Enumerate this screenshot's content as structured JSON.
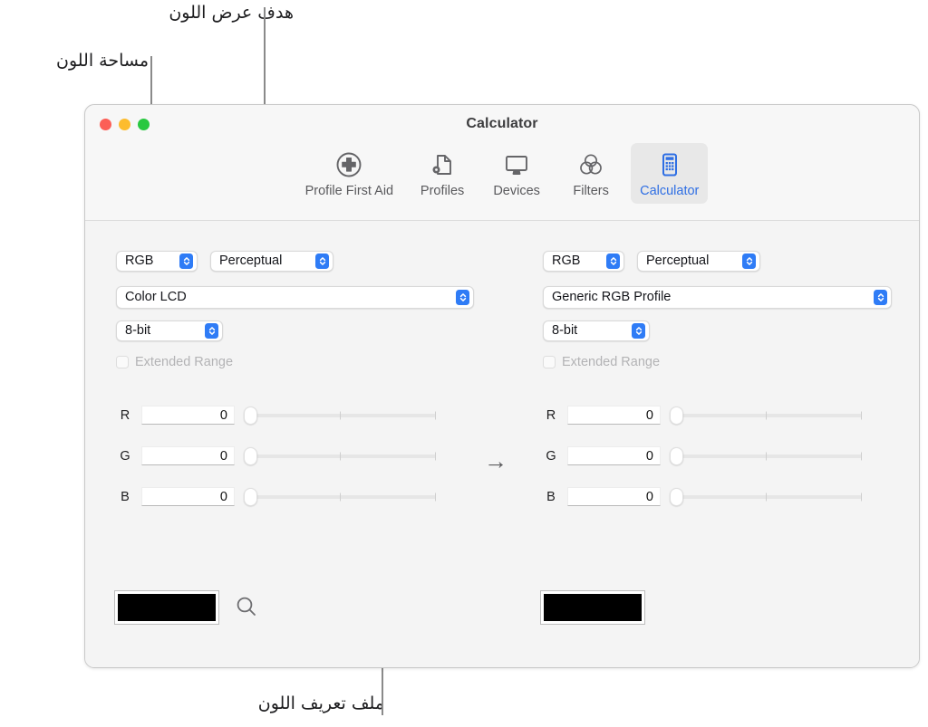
{
  "annotations": [
    {
      "id": "color-space",
      "text": "مساحة اللون"
    },
    {
      "id": "render-intent",
      "text": "هدف عرض اللون"
    },
    {
      "id": "color-profile",
      "text": "ملف تعريف اللون"
    }
  ],
  "window": {
    "title": "Calculator",
    "traffic_lights": {
      "close": "close-button",
      "minimize": "minimize-button",
      "zoom": "zoom-button"
    },
    "toolbar": {
      "items": [
        {
          "label": "Profile First Aid",
          "icon": "first-aid-icon",
          "selected": false
        },
        {
          "label": "Profiles",
          "icon": "profiles-icon",
          "selected": false
        },
        {
          "label": "Devices",
          "icon": "devices-icon",
          "selected": false
        },
        {
          "label": "Filters",
          "icon": "filters-icon",
          "selected": false
        },
        {
          "label": "Calculator",
          "icon": "calculator-icon",
          "selected": true
        }
      ],
      "selected_color": "#2f6fe4"
    }
  },
  "source_panel": {
    "color_space": "RGB",
    "render_intent": "Perceptual",
    "profile": "Color LCD",
    "bit_depth": "8-bit",
    "extended_range_label": "Extended Range",
    "extended_range_checked": false,
    "channels": [
      {
        "name": "R",
        "value": "0",
        "slider_position": 0
      },
      {
        "name": "G",
        "value": "0",
        "slider_position": 0
      },
      {
        "name": "B",
        "value": "0",
        "slider_position": 0
      }
    ],
    "swatch_color": "#000000",
    "picker_icon": "magnifier-icon"
  },
  "target_panel": {
    "color_space": "RGB",
    "render_intent": "Perceptual",
    "profile": "Generic RGB Profile",
    "bit_depth": "8-bit",
    "extended_range_label": "Extended Range",
    "extended_range_checked": false,
    "channels": [
      {
        "name": "R",
        "value": "0",
        "slider_position": 0
      },
      {
        "name": "G",
        "value": "0",
        "slider_position": 0
      },
      {
        "name": "B",
        "value": "0",
        "slider_position": 0
      }
    ],
    "swatch_color": "#000000"
  },
  "conversion_arrow": "→"
}
